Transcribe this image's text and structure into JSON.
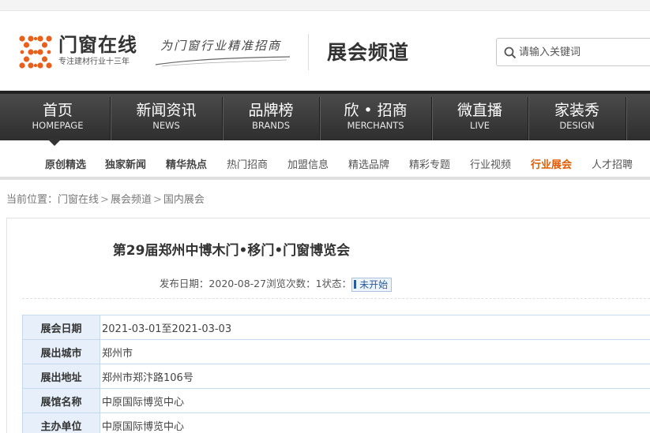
{
  "header": {
    "logo_name": "门窗在线",
    "logo_sub": "专注建材行业十三年",
    "slogan": "为门窗行业精准招商",
    "channel": "展会频道",
    "search_placeholder": "请输入关键词"
  },
  "main_nav": [
    {
      "cn": "首页",
      "en": "HOMEPAGE"
    },
    {
      "cn": "新闻资讯",
      "en": "NEWS"
    },
    {
      "cn": "品牌榜",
      "en": "BRANDS"
    },
    {
      "cn": "欣 • 招商",
      "en": "MERCHANTS"
    },
    {
      "cn": "微直播",
      "en": "LIVE"
    },
    {
      "cn": "家装秀",
      "en": "DESIGN"
    }
  ],
  "sub_nav": [
    "原创精选",
    "独家新闻",
    "精华热点",
    "热门招商",
    "加盟信息",
    "精选品牌",
    "精彩专题",
    "行业视频",
    "行业展会",
    "人才招聘"
  ],
  "breadcrumb": {
    "prefix": "当前位置：",
    "items": [
      "门窗在线",
      "展会频道",
      "国内展会"
    ]
  },
  "article": {
    "title": "第29届郑州中博木门•移门•门窗博览会",
    "publish_label": "发布日期：",
    "publish_date": "2020-08-27",
    "views_label": "浏览次数：",
    "views": "1",
    "status_label": "状态：",
    "status": "未开始"
  },
  "info_rows": [
    {
      "label": "展会日期",
      "value": "2021-03-01至2021-03-03"
    },
    {
      "label": "展出城市",
      "value": "郑州市"
    },
    {
      "label": "展出地址",
      "value": "郑州市郑汴路106号"
    },
    {
      "label": "展馆名称",
      "value": "中原国际博览中心"
    },
    {
      "label": "主办单位",
      "value": "中原国际博览中心"
    }
  ],
  "colors": {
    "accent": "#e35b00",
    "nav_bg": "#3a3a3a",
    "table_label_bg": "#e7f0fa",
    "table_border": "#c7d9ec"
  },
  "icons": {
    "search": "search-icon",
    "logo": "logo-mark-icon"
  }
}
